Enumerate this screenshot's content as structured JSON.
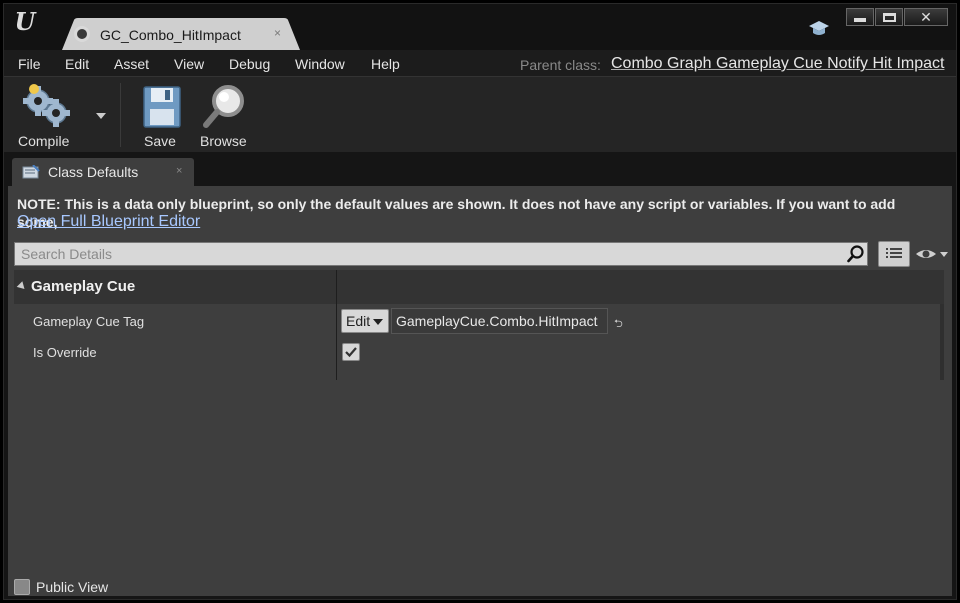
{
  "window": {
    "tab_title": "GC_Combo_HitImpact",
    "tab_close": "×",
    "controls": {
      "minimize": "minimize",
      "maximize": "maximize",
      "close": "✕"
    }
  },
  "menu": {
    "items": [
      "File",
      "Edit",
      "Asset",
      "View",
      "Debug",
      "Window",
      "Help"
    ],
    "parent_class_label": "Parent class:",
    "parent_class_value": "Combo Graph Gameplay Cue Notify Hit Impact"
  },
  "toolbar": {
    "compile_label": "Compile",
    "save_label": "Save",
    "browse_label": "Browse"
  },
  "panel_tab": {
    "label": "Class Defaults",
    "close": "×"
  },
  "details": {
    "note": "NOTE: This is a data only blueprint, so only the default values are shown.  It does not have any script or variables.  If you want to add some,",
    "note_link": "Open Full Blueprint Editor",
    "search_placeholder": "Search Details",
    "category": "Gameplay Cue",
    "properties": [
      {
        "name": "Gameplay Cue Tag",
        "edit_label": "Edit",
        "value": "GameplayCue.Combo.HitImpact"
      },
      {
        "name": "Is Override",
        "checked": true
      }
    ],
    "public_view_label": "Public View"
  },
  "colors": {
    "background": "#151515",
    "panel": "#3e3e3e",
    "link": "#a8c8ff"
  }
}
